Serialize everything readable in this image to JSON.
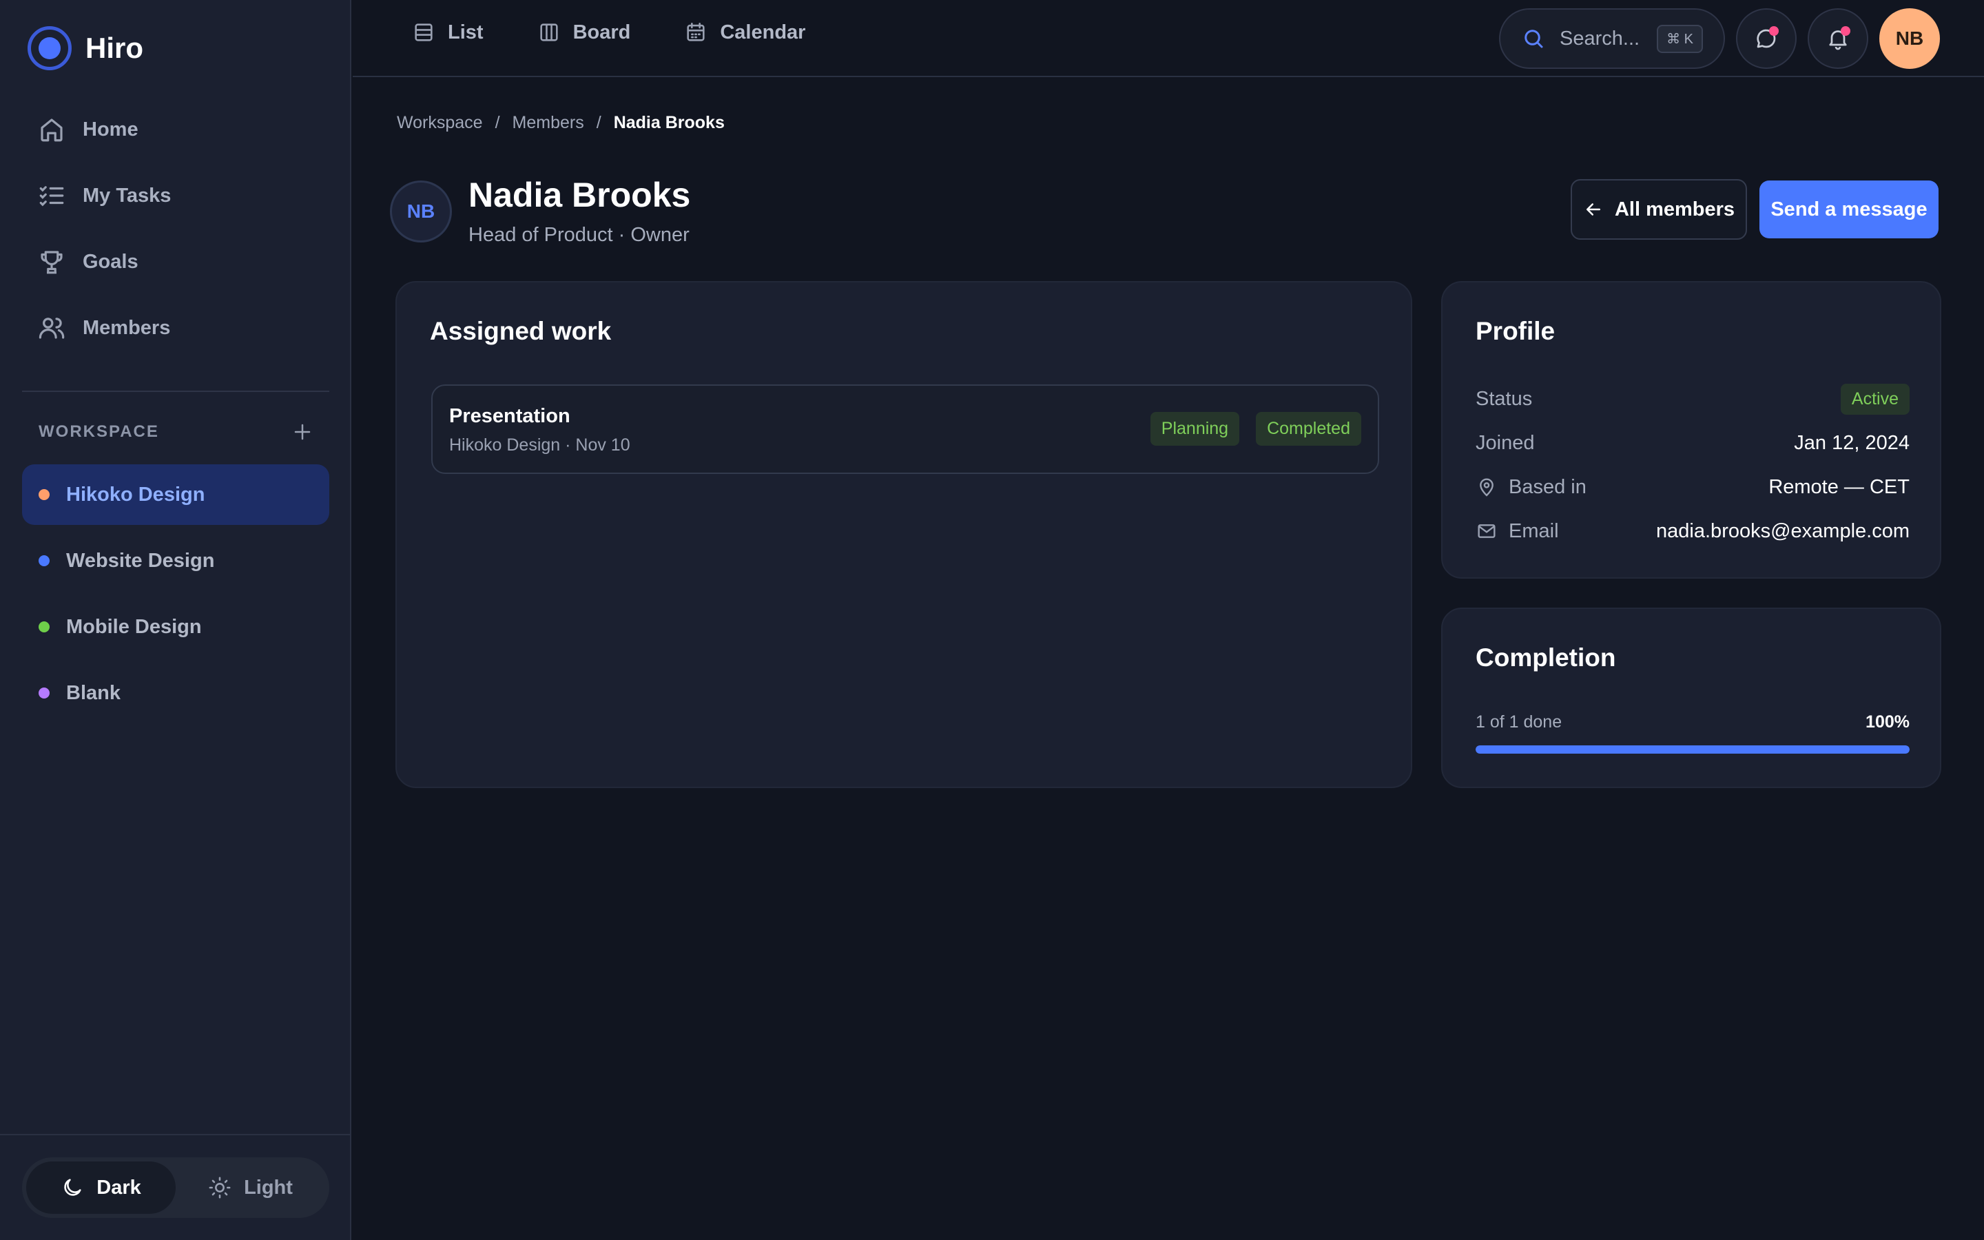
{
  "app": {
    "name": "Hiro",
    "accent": "#4a79ff"
  },
  "sidebar": {
    "nav": [
      {
        "label": "Home",
        "icon": "home-icon"
      },
      {
        "label": "My Tasks",
        "icon": "tasks-icon"
      },
      {
        "label": "Goals",
        "icon": "trophy-icon"
      },
      {
        "label": "Members",
        "icon": "users-icon"
      }
    ],
    "workspace_header": "WORKSPACE",
    "workspaces": [
      {
        "label": "Hikoko Design",
        "color": "#ff9f6b",
        "active": true
      },
      {
        "label": "Website Design",
        "color": "#4a79ff",
        "active": false
      },
      {
        "label": "Mobile Design",
        "color": "#6fcf4a",
        "active": false
      },
      {
        "label": "Blank",
        "color": "#b57bff",
        "active": false
      }
    ],
    "theme": {
      "dark_label": "Dark",
      "light_label": "Light",
      "selected": "Dark"
    }
  },
  "topbar": {
    "tabs": [
      {
        "label": "List",
        "icon": "list-icon"
      },
      {
        "label": "Board",
        "icon": "board-icon"
      },
      {
        "label": "Calendar",
        "icon": "calendar-icon"
      }
    ],
    "search": {
      "placeholder": "Search...",
      "shortcut": "⌘ K"
    },
    "avatar_initials": "NB"
  },
  "breadcrumb": [
    "Workspace",
    "Members",
    "Nadia Brooks"
  ],
  "member": {
    "initials": "NB",
    "name": "Nadia Brooks",
    "role": "Head of Product · Owner"
  },
  "actions": {
    "back_label": "All members",
    "message_label": "Send a message"
  },
  "assigned_work": {
    "title": "Assigned work",
    "items": [
      {
        "title": "Presentation",
        "subtitle": "Hikoko Design · Nov 10",
        "tags": [
          "Planning",
          "Completed"
        ]
      }
    ]
  },
  "profile": {
    "title": "Profile",
    "status_label": "Status",
    "status_value": "Active",
    "joined_label": "Joined",
    "joined_value": "Jan 12, 2024",
    "based_label": "Based in",
    "based_value": "Remote — CET",
    "email_label": "Email",
    "email_value": "nadia.brooks@example.com"
  },
  "completion": {
    "title": "Completion",
    "label": "1 of 1 done",
    "percent_text": "100%",
    "fraction": 1.0
  }
}
